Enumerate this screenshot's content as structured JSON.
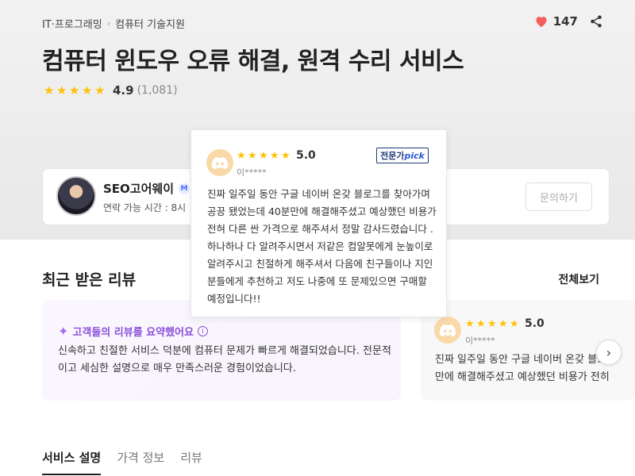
{
  "breadcrumb": {
    "level1": "IT·프로그래밍",
    "level2": "컴퓨터 기술지원"
  },
  "like_count": "147",
  "title": "컴퓨터 윈도우 오류 해결, 원격 수리 서비스",
  "rating": {
    "score": "4.9",
    "count": "(1,081)",
    "stars": 5
  },
  "seller": {
    "name": "SEO고어웨이",
    "badge": "M",
    "contact": "연락 가능 시간 : 8시",
    "inquiry_label": "문의하기"
  },
  "reviews_section": {
    "title": "최근 받은 리뷰",
    "view_all": "전체보기",
    "summary": {
      "heading": "고객들의 리뷰를 요약했어요",
      "text": "신속하고 친절한 서비스 덕분에 컴퓨터 문제가 빠르게 해결되었습니다. 전문적이고 세심한 설명으로 매우 만족스러운 경험이었습니다."
    },
    "card2": {
      "score": "5.0",
      "user": "이*****",
      "line1": "진짜 일주일 동안 구글 네이버 온갖 블로",
      "line2": "만에 해결해주셨고 예상했던 비용가 전히"
    }
  },
  "popup_review": {
    "score": "5.0",
    "user": "이*****",
    "badge_prefix": "전문가",
    "badge_pick": "pick",
    "text": "진짜 일주일 동안 구글 네이버 온갖 블로그를 찾아가며 공끙 됐었는데 40분만에 해결해주셨고 예상했던 비용가 전혀 다른 싼 가격으로 해주셔서 정말 감사드렸습니다 . 하나하나 다 알려주시면서 저같은 컴알못에게 눈높이로 알려주시고 친절하게 해주셔서 다음에 친구들이나 지인 분들에게 추천하고 저도 나중에 또 문제있으면 구매할 예정입니다!!"
  },
  "tabs": [
    "서비스 설명",
    "가격 정보",
    "리뷰"
  ],
  "colors": {
    "star": "#ffc107",
    "heart": "#f25f5c",
    "ai_purple": "#8a4fd8",
    "pick_navy": "#1d3a7a"
  }
}
